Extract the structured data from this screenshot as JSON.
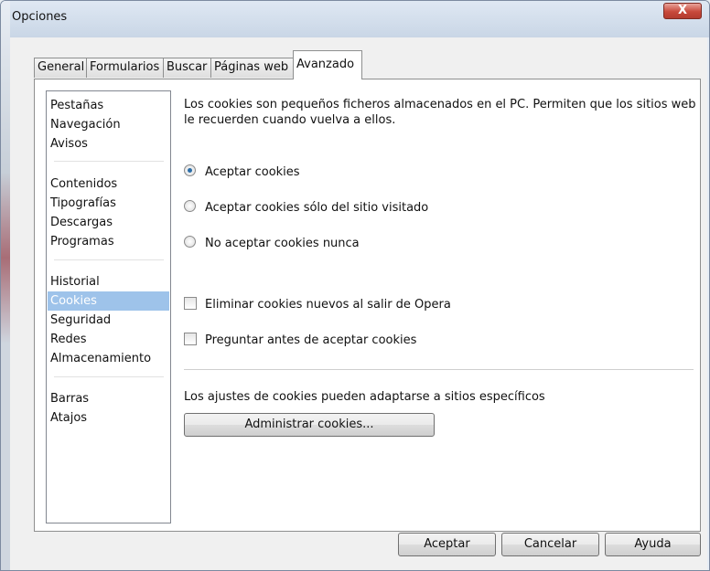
{
  "window": {
    "title": "Opciones",
    "close_label": "X"
  },
  "tabs": [
    {
      "label": "General"
    },
    {
      "label": "Formularios"
    },
    {
      "label": "Buscar"
    },
    {
      "label": "Páginas web"
    },
    {
      "label": "Avanzado"
    }
  ],
  "sidebar": {
    "items": [
      {
        "label": "Pestañas"
      },
      {
        "label": "Navegación"
      },
      {
        "label": "Avisos"
      },
      {
        "label": "Contenidos"
      },
      {
        "label": "Tipografías"
      },
      {
        "label": "Descargas"
      },
      {
        "label": "Programas"
      },
      {
        "label": "Historial"
      },
      {
        "label": "Cookies"
      },
      {
        "label": "Seguridad"
      },
      {
        "label": "Redes"
      },
      {
        "label": "Almacenamiento"
      },
      {
        "label": "Barras"
      },
      {
        "label": "Atajos"
      }
    ],
    "selected": "Cookies"
  },
  "content": {
    "description": "Los cookies son pequeños ficheros almacenados en el PC. Permiten que los sitios web le recuerden cuando vuelva a ellos.",
    "radios": [
      {
        "label": "Aceptar cookies",
        "checked": true
      },
      {
        "label": "Aceptar cookies sólo del sitio visitado",
        "checked": false
      },
      {
        "label": "No aceptar cookies nunca",
        "checked": false
      }
    ],
    "checkboxes": [
      {
        "label": "Eliminar cookies nuevos al salir de Opera",
        "checked": false
      },
      {
        "label": "Preguntar antes de aceptar cookies",
        "checked": false
      }
    ],
    "site_note": "Los ajustes de cookies pueden adaptarse a sitios específicos",
    "manage_button": "Administrar cookies..."
  },
  "footer": {
    "accept": "Aceptar",
    "cancel": "Cancelar",
    "help": "Ayuda"
  },
  "colors": {
    "selection": "#9ec3ea",
    "close": "#c8493b",
    "radio_dot": "#2d6ea8"
  }
}
